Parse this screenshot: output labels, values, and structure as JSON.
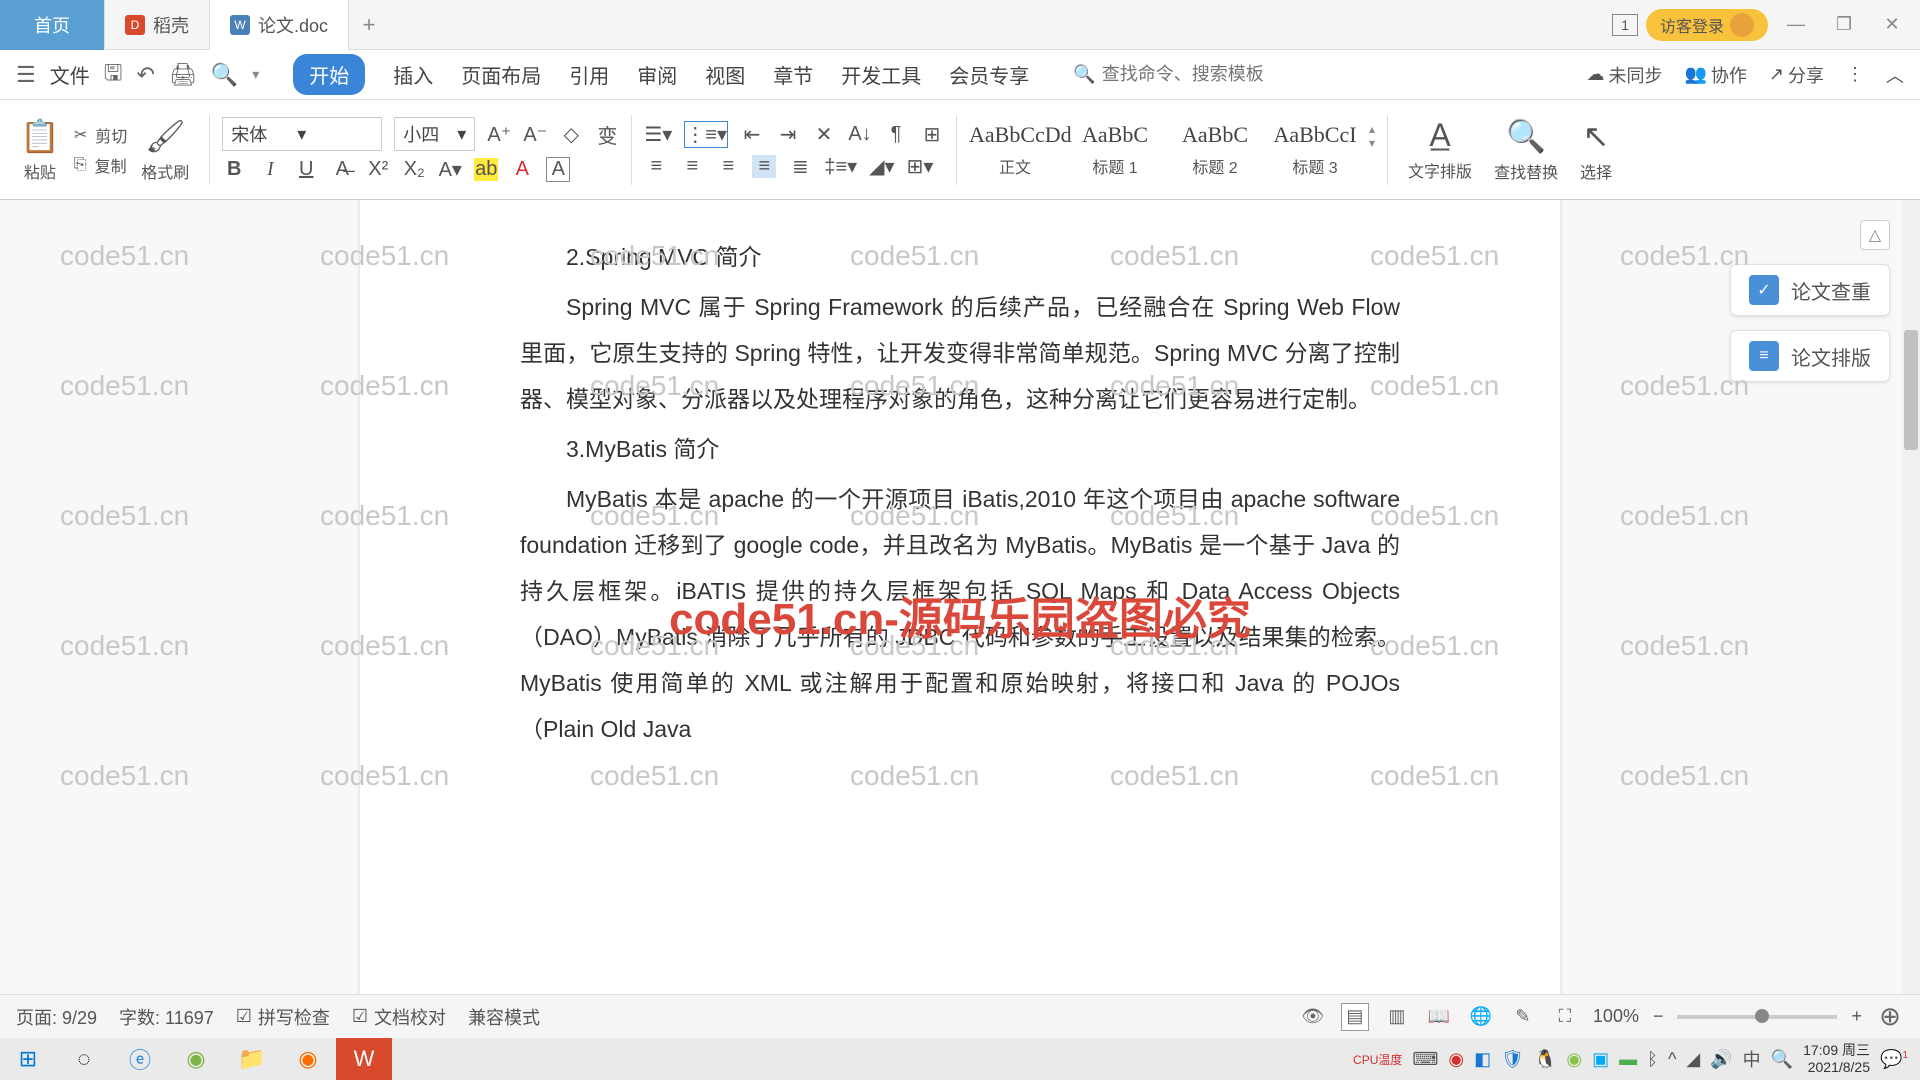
{
  "titlebar": {
    "home": "首页",
    "tab1": "稻壳",
    "tab2": "论文.doc",
    "newtab": "+",
    "num_badge": "1",
    "login": "访客登录",
    "minimize": "—",
    "restore": "❐",
    "close": "✕"
  },
  "menubar": {
    "file": "文件",
    "items": [
      "开始",
      "插入",
      "页面布局",
      "引用",
      "审阅",
      "视图",
      "章节",
      "开发工具",
      "会员专享"
    ],
    "search_placeholder": "查找命令、搜索模板",
    "sync": "未同步",
    "collab": "协作",
    "share": "分享"
  },
  "ribbon": {
    "paste": "粘贴",
    "cut": "剪切",
    "copy": "复制",
    "format_painter": "格式刷",
    "font_name": "宋体",
    "font_size": "小四",
    "styles": [
      {
        "preview": "AaBbCcDd",
        "label": "正文"
      },
      {
        "preview": "AaBbC",
        "label": "标题 1"
      },
      {
        "preview": "AaBbC",
        "label": "标题 2"
      },
      {
        "preview": "AaBbCcI",
        "label": "标题 3"
      }
    ],
    "text_layout": "文字排版",
    "find_replace": "查找替换",
    "select": "选择"
  },
  "document": {
    "h2": "2.Spring MVC 简介",
    "p1": "Spring MVC 属于 Spring Framework 的后续产品，已经融合在 Spring Web Flow 里面，它原生支持的 Spring 特性，让开发变得非常简单规范。Spring MVC 分离了控制器、模型对象、分派器以及处理程序对象的角色，这种分离让它们更容易进行定制。",
    "h3": "3.MyBatis 简介",
    "p2": "MyBatis 本是 apache 的一个开源项目 iBatis,2010 年这个项目由 apache software foundation 迁移到了 google code，并且改名为 MyBatis。MyBatis 是一个基于 Java 的持久层框架。iBATIS 提供的持久层框架包括 SQL Maps 和 Data Access Objects（DAO）MyBatis 消除了几乎所有的 JDBC 代码和参数的手工设置以及结果集的检索。MyBatis 使用简单的 XML 或注解用于配置和原始映射，将接口和 Java 的 POJOs（Plain Old Java"
  },
  "big_watermark": "code51.cn-源码乐园盗图必究",
  "watermark_text": "code51.cn",
  "side": {
    "check": "论文查重",
    "layout": "论文排版"
  },
  "statusbar": {
    "page": "页面: 9/29",
    "words": "字数: 11697",
    "spell": "拼写检查",
    "proof": "文档校对",
    "compat": "兼容模式",
    "zoom": "100%"
  },
  "taskbar": {
    "cpu_label": "CPU温度",
    "ime": "中",
    "time": "17:09 周三",
    "date": "2021/8/25",
    "notif_count": "1"
  }
}
